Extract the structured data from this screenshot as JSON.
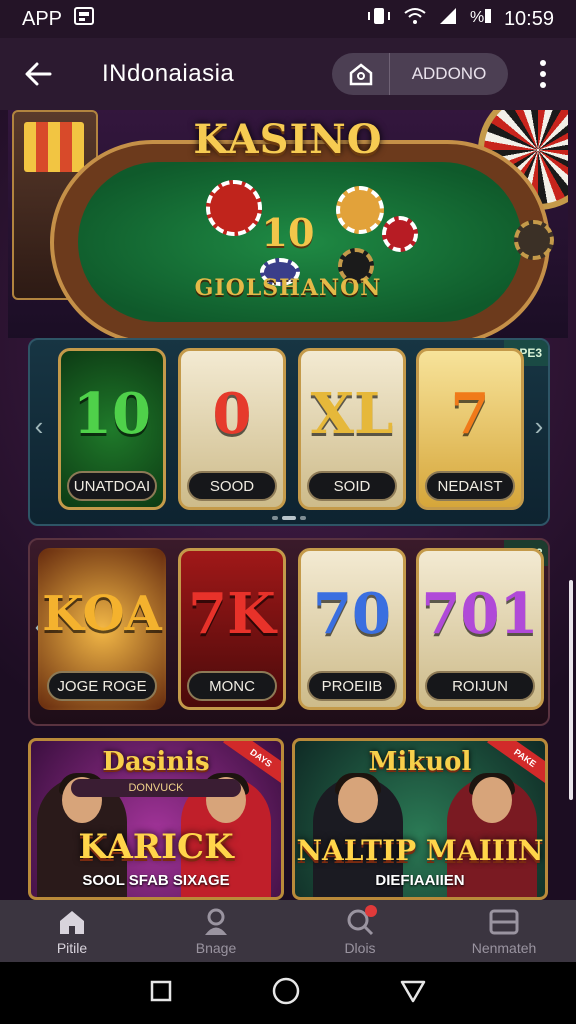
{
  "status_bar": {
    "app": "APP",
    "time": "10:59"
  },
  "app_bar": {
    "title": "INdonaiasia",
    "pill_label": "ADDONO"
  },
  "hero": {
    "title": "KASINO",
    "center_number": "10",
    "felt_text": "GIOLSHANON"
  },
  "reel_row_1": {
    "badge": "OPE3",
    "reels": [
      {
        "symbol": "10",
        "label": "UNATDOAI",
        "color": "#4fd14a"
      },
      {
        "symbol": "0",
        "label": "SOOD",
        "color": "#e63a2c"
      },
      {
        "symbol": "XL",
        "label": "SOID",
        "color": "#e6b83a"
      },
      {
        "symbol": "7",
        "label": "NEDAIST",
        "color": "#f07a1a"
      }
    ]
  },
  "reel_row_2": {
    "badge": "OOE3",
    "reels": [
      {
        "symbol": "KOA",
        "label": "JOGE  ROGE",
        "color": "#f4b22e"
      },
      {
        "symbol": "7K",
        "label": "MONC",
        "color": "#e8322a"
      },
      {
        "symbol": "70",
        "label": "PROEIIB",
        "color": "#3a6fe0"
      },
      {
        "symbol": "701",
        "label": "ROIJUN",
        "color": "#b04ad8"
      }
    ]
  },
  "promos": [
    {
      "title": "Dasinis",
      "subtitle": "DONVUCK",
      "main": "KARICK",
      "footer": "SOOL SFAB SIXAGE",
      "ribbon": "DAYS"
    },
    {
      "title": "Mikuol",
      "subtitle": "",
      "main": "NALTIP MAIIIN",
      "footer": "DIEFIAAIIEN",
      "ribbon": "PAKE"
    }
  ],
  "bottom_nav": [
    {
      "label": "Pitile",
      "icon": "home-icon"
    },
    {
      "label": "Bnage",
      "icon": "person-icon"
    },
    {
      "label": "Dlois",
      "icon": "search-icon"
    },
    {
      "label": "Nenmateh",
      "icon": "list-icon"
    }
  ]
}
